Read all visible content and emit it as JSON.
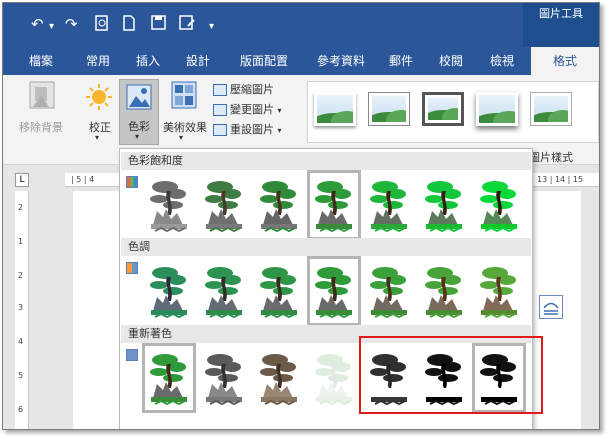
{
  "qat": {
    "undo": "↶",
    "undo_caret": "▾",
    "redo": "↷",
    "print_preview": "🔍",
    "new_doc": "🗋",
    "save": "💾",
    "save_as": "💾",
    "customize": "▾"
  },
  "context_tab_title": "圖片工具",
  "tabs": [
    "檔案",
    "常用",
    "插入",
    "設計",
    "版面配置",
    "參考資料",
    "郵件",
    "校閱",
    "檢視",
    "格式"
  ],
  "ribbon": {
    "remove_bg": "移除背景",
    "corrections": "校正",
    "color": "色彩",
    "artistic": "美術效果",
    "compress": "壓縮圖片",
    "change": "變更圖片",
    "reset": "重設圖片",
    "caret": "▾",
    "styles_group": "圖片樣式"
  },
  "ruler": {
    "corner": "L",
    "h_left": "| 5 | 4",
    "h_right": "13 | 14 | 15",
    "v_marks": [
      "2",
      "1",
      "2",
      "3",
      "4",
      "5",
      "6"
    ]
  },
  "gallery": {
    "saturation_title": "色彩飽和度",
    "tone_title": "色調",
    "recolor_title": "重新著色",
    "saturation_thumbs": 7,
    "tone_thumbs": 7,
    "recolor_thumbs": 7,
    "selected_saturation": 3,
    "selected_tone": 3,
    "selected_recolor_first": 0,
    "selected_recolor_last": 6
  },
  "colors": {
    "title_bar": "#2b579a",
    "ribbon_bg": "#f3f3f3",
    "highlight": "#e0191b",
    "pine_green": "#2e9a3a",
    "rock_gray": "#6a6a6a"
  }
}
